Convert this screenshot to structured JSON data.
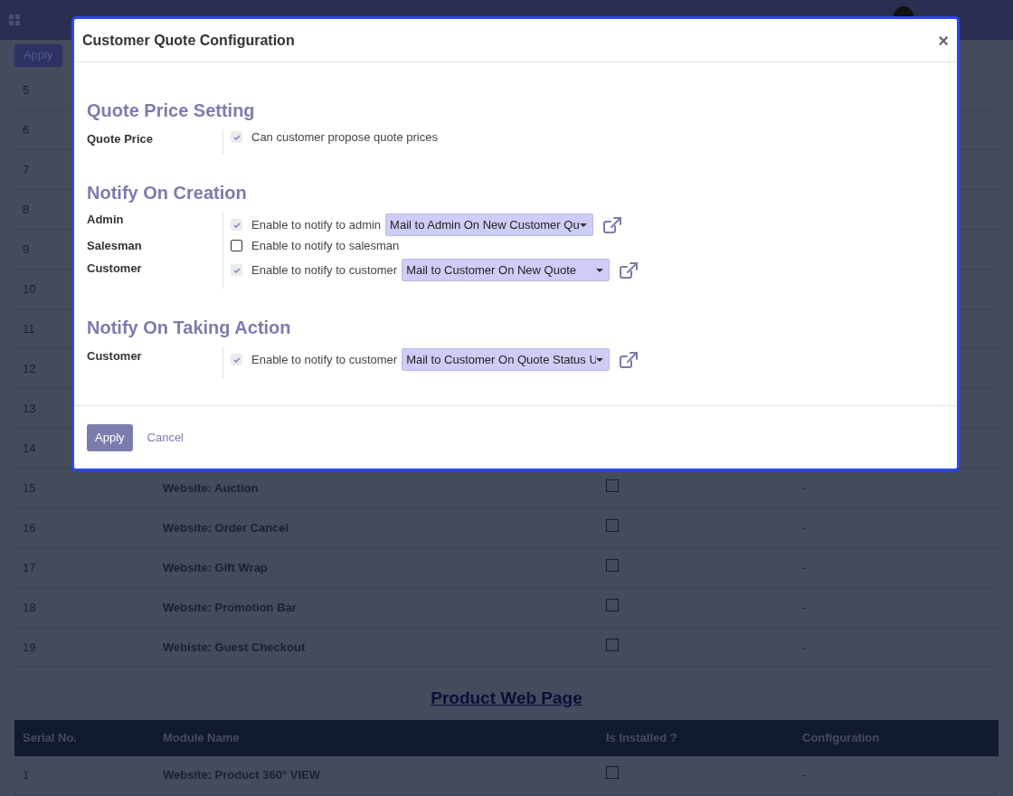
{
  "control_panel": {
    "apply_button": "Apply"
  },
  "modules_table": {
    "rows": [
      {
        "serial": "5"
      },
      {
        "serial": "6"
      },
      {
        "serial": "7"
      },
      {
        "serial": "8"
      },
      {
        "serial": "9"
      },
      {
        "serial": "10"
      },
      {
        "serial": "11"
      },
      {
        "serial": "12"
      },
      {
        "serial": "13"
      },
      {
        "serial": "14"
      },
      {
        "serial": "15",
        "name": "Website: Auction",
        "installed": false,
        "configuration": "-"
      },
      {
        "serial": "16",
        "name": "Website: Order Cancel",
        "installed": false,
        "configuration": "-"
      },
      {
        "serial": "17",
        "name": "Website: Gift Wrap",
        "installed": false,
        "configuration": "-"
      },
      {
        "serial": "18",
        "name": "Website: Promotion Bar",
        "installed": false,
        "configuration": "-"
      },
      {
        "serial": "19",
        "name": "Webiste: Guest Checkout",
        "installed": false,
        "configuration": "-"
      }
    ]
  },
  "product_section": {
    "title": "Product Web Page",
    "columns": [
      "Serial No.",
      "Module Name",
      "Is Installed ?",
      "Configuration"
    ],
    "rows": [
      {
        "serial": "1",
        "name": "Website: Product 360° VIEW",
        "installed": false,
        "configuration": "-"
      }
    ]
  },
  "dialog": {
    "title": "Customer Quote Configuration",
    "close": "×",
    "sections": [
      {
        "heading": "Quote Price Setting",
        "rows": [
          {
            "label": "Quote Price",
            "checked": true,
            "text": "Can customer propose quote prices"
          }
        ]
      },
      {
        "heading": "Notify On Creation",
        "rows": [
          {
            "label": "Admin",
            "checked": true,
            "text": "Enable to notify to admin",
            "template": "Mail to Admin On New Customer Qu"
          },
          {
            "label": "Salesman",
            "checked": false,
            "text": "Enable to notify to salesman"
          },
          {
            "label": "Customer",
            "checked": true,
            "text": "Enable to notify to customer",
            "template": "Mail to Customer On New Quote"
          }
        ]
      },
      {
        "heading": "Notify On Taking Action",
        "rows": [
          {
            "label": "Customer",
            "checked": true,
            "text": "Enable to notify to customer",
            "template": "Mail to Customer On Quote Status U"
          }
        ]
      }
    ],
    "buttons": [
      {
        "label": "Apply",
        "kind": "primary"
      },
      {
        "label": "Cancel",
        "kind": "link"
      }
    ]
  }
}
